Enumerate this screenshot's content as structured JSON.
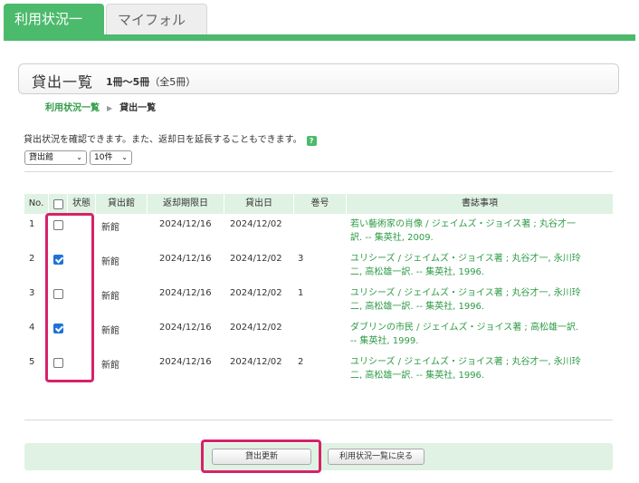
{
  "tabs": [
    {
      "label": "利用状況一覧",
      "active": true
    },
    {
      "label": "マイフォルダ",
      "active": false
    }
  ],
  "heading": {
    "title": "貸出一覧",
    "count_range": "1冊～5冊",
    "count_total": "（全5冊）"
  },
  "breadcrumb": {
    "link": "利用状況一覧",
    "separator": "▶",
    "current": "貸出一覧"
  },
  "description": "貸出状況を確認できます。また、返却日を延長することもできます。",
  "help_icon": "?",
  "filters": {
    "sort_select": "貸出館",
    "per_page_select": "10件"
  },
  "table": {
    "headers": [
      "No.",
      "状態",
      "貸出館",
      "返却期限日",
      "貸出日",
      "巻号",
      "書誌事項"
    ],
    "rows": [
      {
        "no": "1",
        "checked": false,
        "library": "新館",
        "due": "2024/12/16",
        "loan": "2024/12/02",
        "volume": "",
        "title_line1": "若い藝術家の肖像 / ジェイムズ・ジョイス著 ; 丸谷才一",
        "title_line2": "訳. -- 集英社, 2009."
      },
      {
        "no": "2",
        "checked": true,
        "library": "新館",
        "due": "2024/12/16",
        "loan": "2024/12/02",
        "volume": "3",
        "title_line1": "ユリシーズ / ジェイムズ・ジョイス著 ; 丸谷才一, 永川玲",
        "title_line2": "二, 高松雄一訳. -- 集英社, 1996."
      },
      {
        "no": "3",
        "checked": false,
        "library": "新館",
        "due": "2024/12/16",
        "loan": "2024/12/02",
        "volume": "1",
        "title_line1": "ユリシーズ / ジェイムズ・ジョイス著 ; 丸谷才一, 永川玲",
        "title_line2": "二, 高松雄一訳. -- 集英社, 1996."
      },
      {
        "no": "4",
        "checked": true,
        "library": "新館",
        "due": "2024/12/16",
        "loan": "2024/12/02",
        "volume": "",
        "title_line1": "ダブリンの市民 / ジェイムズ・ジョイス著 ; 高松雄一訳.",
        "title_line2": "-- 集英社, 1999."
      },
      {
        "no": "5",
        "checked": false,
        "library": "新館",
        "due": "2024/12/16",
        "loan": "2024/12/02",
        "volume": "2",
        "title_line1": "ユリシーズ / ジェイムズ・ジョイス著 ; 丸谷才一, 永川玲",
        "title_line2": "二, 高松雄一訳. -- 集英社, 1996."
      }
    ]
  },
  "buttons": {
    "renew": "貸出更新",
    "back": "利用状況一覧に戻る"
  },
  "colors": {
    "accent": "#4cba6c",
    "link": "#2e9b45",
    "highlight": "#d6226b",
    "checkbox_checked": "#1e73d6"
  }
}
